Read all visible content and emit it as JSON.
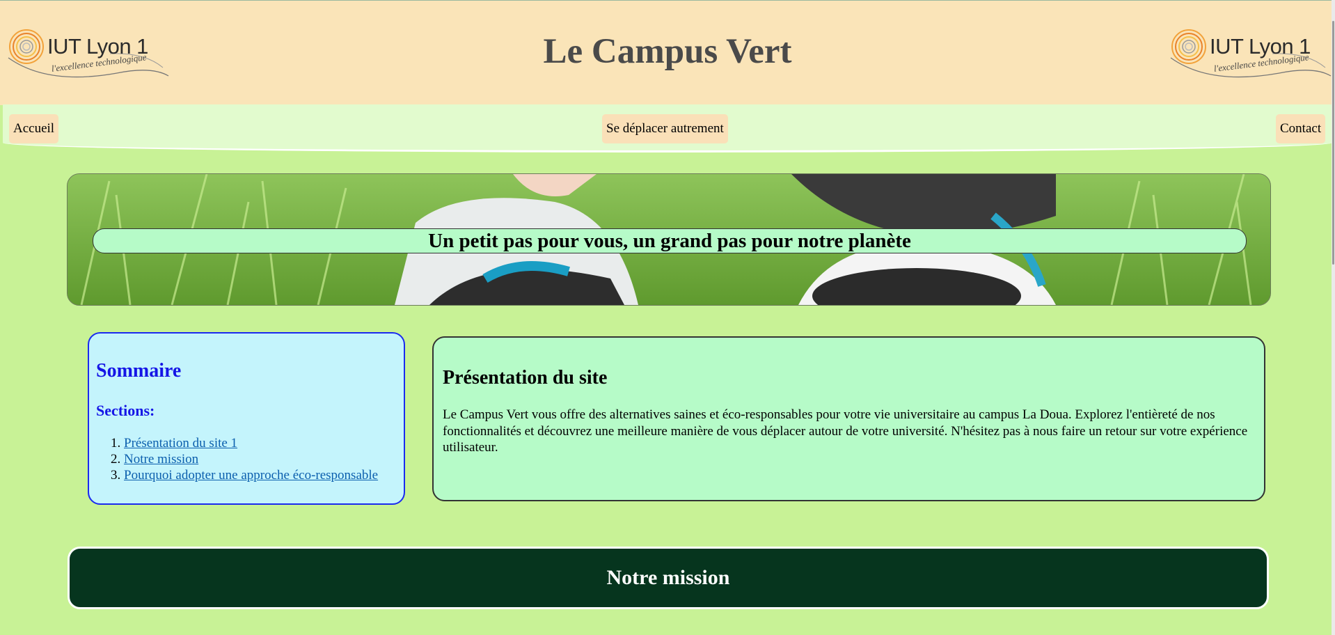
{
  "header": {
    "title": "Le Campus Vert",
    "logo_text": "IUT Lyon 1",
    "logo_tagline": "l'excellence technologique"
  },
  "nav": {
    "items": [
      "Accueil",
      "Se déplacer autrement",
      "Contact"
    ]
  },
  "banner": {
    "slogan": "Un petit pas pour vous, un grand pas pour notre planète"
  },
  "sommaire": {
    "title": "Sommaire",
    "subtitle": "Sections:",
    "links": [
      "Présentation du site 1",
      "Notre mission",
      "Pourquoi adopter une approche éco-responsable"
    ]
  },
  "presentation": {
    "title": "Présentation du site",
    "text": "Le Campus Vert vous offre des alternatives saines et éco-responsables pour votre vie universitaire au campus La Doua. Explorez l'entièreté de nos fonctionnalités et découvrez une meilleure manière de vous déplacer autour de votre université. N'hésitez pas à nous faire un retour sur votre expérience utilisateur."
  },
  "mission": {
    "title": "Notre mission"
  },
  "colors": {
    "header_bg": "#fae4b8",
    "nav_bg": "#e2fbce",
    "page_bg": "#c8f296",
    "sommaire_bg": "#c4f4fc",
    "section_bg": "#b6fbc8",
    "mission_bg": "#06351e"
  },
  "icons": [
    "iut-lyon1-logo-icon"
  ]
}
